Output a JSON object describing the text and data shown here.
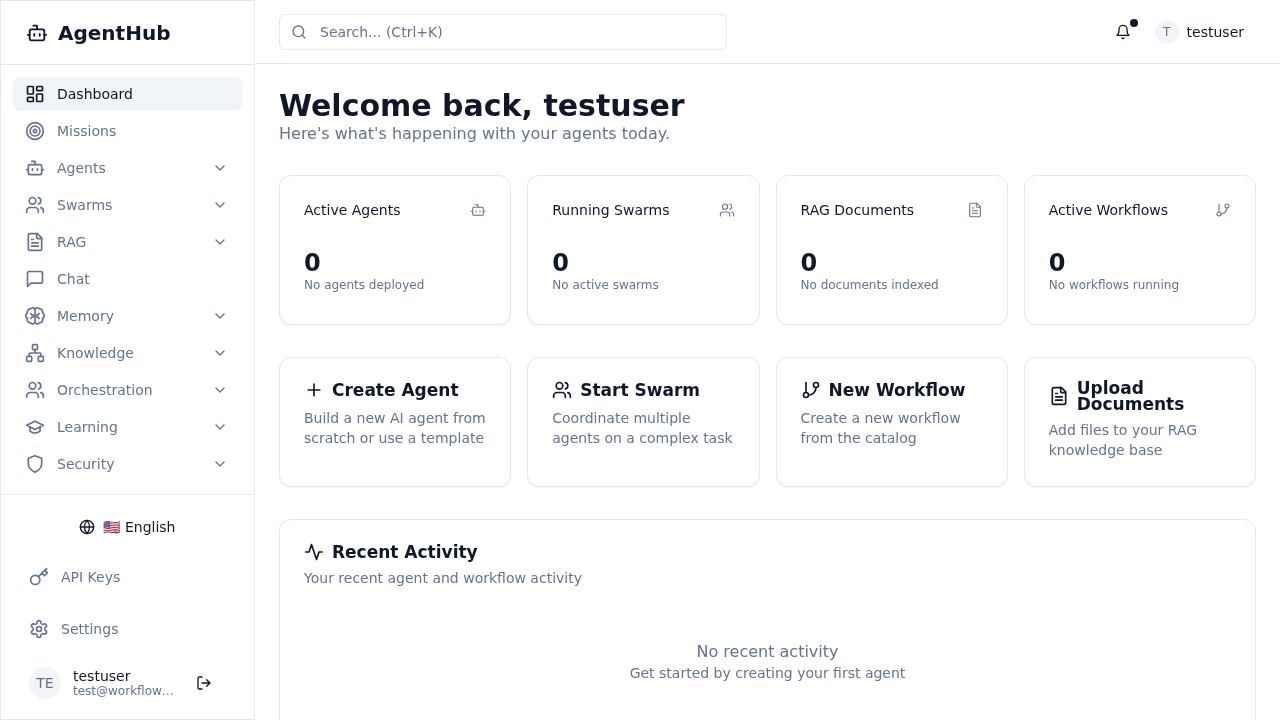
{
  "sidebar": {
    "brand": "AgentHub",
    "nav": [
      {
        "label": "Dashboard",
        "selected": true,
        "has_submenu": false
      },
      {
        "label": "Missions",
        "selected": false,
        "has_submenu": false
      },
      {
        "label": "Agents",
        "selected": false,
        "has_submenu": true
      },
      {
        "label": "Swarms",
        "selected": false,
        "has_submenu": true
      },
      {
        "label": "RAG",
        "selected": false,
        "has_submenu": true
      },
      {
        "label": "Chat",
        "selected": false,
        "has_submenu": false
      },
      {
        "label": "Memory",
        "selected": false,
        "has_submenu": true
      },
      {
        "label": "Knowledge",
        "selected": false,
        "has_submenu": true
      },
      {
        "label": "Orchestration",
        "selected": false,
        "has_submenu": true
      },
      {
        "label": "Learning",
        "selected": false,
        "has_submenu": true
      },
      {
        "label": "Security",
        "selected": false,
        "has_submenu": true
      }
    ],
    "language": {
      "flag": "🇺🇸",
      "label": "English"
    },
    "footer_links": [
      "API Keys",
      "Settings"
    ],
    "user": {
      "initials": "TE",
      "name": "testuser",
      "email": "test@workflow…"
    }
  },
  "header": {
    "search": {
      "placeholder": "Search... (Ctrl+K)"
    },
    "notifications": {
      "unread": true
    },
    "user": {
      "initial": "T",
      "name": "testuser"
    }
  },
  "page": {
    "title": "Welcome back, testuser",
    "subtitle": "Here's what's happening with your agents today."
  },
  "stats": [
    {
      "title": "Active Agents",
      "value": "0",
      "note": "No agents deployed"
    },
    {
      "title": "Running Swarms",
      "value": "0",
      "note": "No active swarms"
    },
    {
      "title": "RAG Documents",
      "value": "0",
      "note": "No documents indexed"
    },
    {
      "title": "Active Workflows",
      "value": "0",
      "note": "No workflows running"
    }
  ],
  "actions": [
    {
      "title": "Create Agent",
      "description": "Build a new AI agent from scratch or use a template"
    },
    {
      "title": "Start Swarm",
      "description": "Coordinate multiple agents on a complex task"
    },
    {
      "title": "New Workflow",
      "description": "Create a new workflow from the catalog"
    },
    {
      "title": "Upload Documents",
      "description": "Add files to your RAG knowledge base"
    }
  ],
  "recent_activity": {
    "title": "Recent Activity",
    "subtitle": "Your recent agent and workflow activity",
    "empty_title": "No recent activity",
    "empty_hint": "Get started by creating your first agent"
  }
}
